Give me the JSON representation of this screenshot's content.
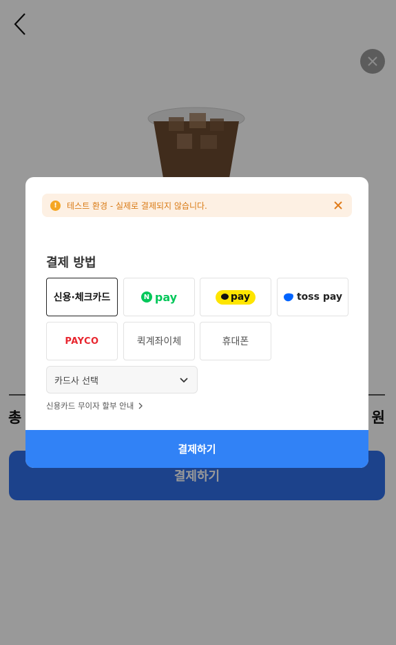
{
  "background": {
    "total_label": "총",
    "total_amount_suffix": "원",
    "pay_button_label": "결제하기"
  },
  "modal": {
    "notice_text": "테스트 환경 - 실제로 결제되지 않습니다.",
    "section_title": "결제 방법",
    "methods": [
      {
        "label": "신용·체크카드"
      },
      {
        "label": "pay"
      },
      {
        "label": "pay"
      },
      {
        "label": "toss pay"
      },
      {
        "label": "PAYCO"
      },
      {
        "label": "퀵계좌이체"
      },
      {
        "label": "휴대폰"
      }
    ],
    "card_select_label": "카드사 선택",
    "installment_text": "신용카드 무이자 할부 안내",
    "pay_button_label": "결제하기"
  },
  "colors": {
    "primary": "#3182f6",
    "notice_bg": "#fdf0e3",
    "notice_text": "#d97a14",
    "npay_green": "#03c75a",
    "kakao_yellow": "#fee500",
    "payco_red": "#e8252e"
  }
}
